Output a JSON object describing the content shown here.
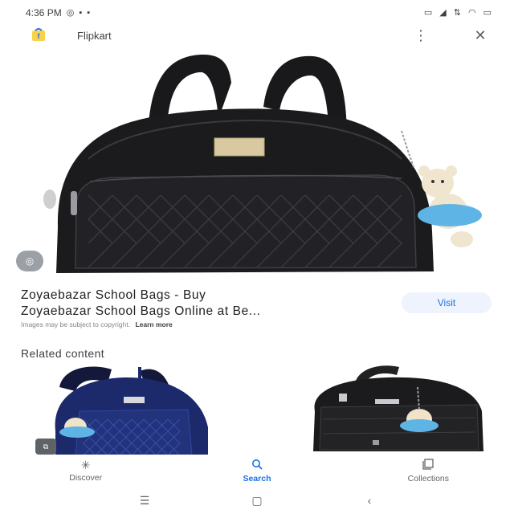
{
  "status_bar": {
    "time": "4:36 PM",
    "left_icons": [
      "whatsapp-icon",
      "notification-icon",
      "notification-icon"
    ],
    "right_icons": [
      "vibrate-icon",
      "signal-icon",
      "data-icon",
      "wifi-icon",
      "battery-icon"
    ]
  },
  "header": {
    "site_name": "Flipkart",
    "menu_icon": "more-vert-icon",
    "close_icon": "close-icon"
  },
  "result": {
    "title_line1": "Zoyaebazar School Bags - Buy",
    "title_line2": "Zoyaebazar School Bags Online at Be...",
    "visit_label": "Visit",
    "copyright_text": "Images may be subject to copyright.",
    "learn_more": "Learn more"
  },
  "related": {
    "header": "Related content"
  },
  "bottom_nav": {
    "items": [
      {
        "label": "Discover",
        "icon": "asterisk-icon"
      },
      {
        "label": "Search",
        "icon": "search-icon",
        "active": true
      },
      {
        "label": "Collections",
        "icon": "collections-icon"
      }
    ]
  },
  "colors": {
    "accent": "#1a73e8",
    "bag_black": "#1b1b1d",
    "bag_navy": "#1c2a6b",
    "teddy_blue": "#5fb4e6",
    "visit_bg": "#eef3fd"
  }
}
